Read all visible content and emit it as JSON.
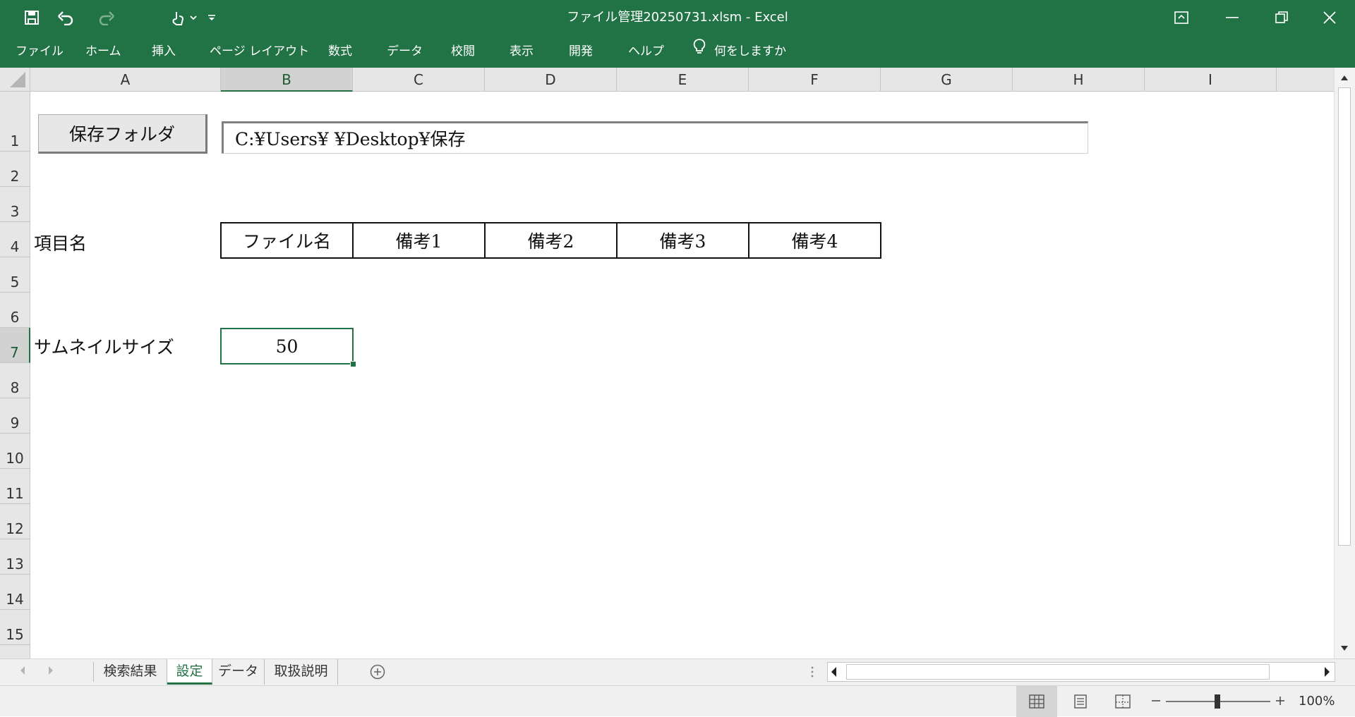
{
  "window": {
    "title": "ファイル管理20250731.xlsm  -  Excel"
  },
  "ribbon": {
    "tabs": [
      "ファイル",
      "ホーム",
      "挿入",
      "ページ レイアウト",
      "数式",
      "データ",
      "校閲",
      "表示",
      "開発",
      "ヘルプ"
    ],
    "tell_me": "何をしますか"
  },
  "columns": [
    "A",
    "B",
    "C",
    "D",
    "E",
    "F",
    "G",
    "H",
    "I"
  ],
  "selected_column": "B",
  "rows": [
    "1",
    "2",
    "3",
    "4",
    "5",
    "6",
    "7",
    "8",
    "9",
    "10",
    "11",
    "12",
    "13",
    "14",
    "15"
  ],
  "selected_row": "7",
  "sheet": {
    "folder_button": "保存フォルダ",
    "folder_path": "C:¥Users¥  ¥Desktop¥保存",
    "item_label": "項目名",
    "headers": [
      "ファイル名",
      "備考1",
      "備考2",
      "備考3",
      "備考4"
    ],
    "thumb_label": "サムネイルサイズ",
    "thumb_value": "50"
  },
  "sheet_tabs": [
    "検索結果",
    "設定",
    "データ",
    "取扱説明"
  ],
  "active_sheet_tab": "設定",
  "status": {
    "zoom": "100%"
  },
  "colors": {
    "excel_green": "#217346"
  }
}
